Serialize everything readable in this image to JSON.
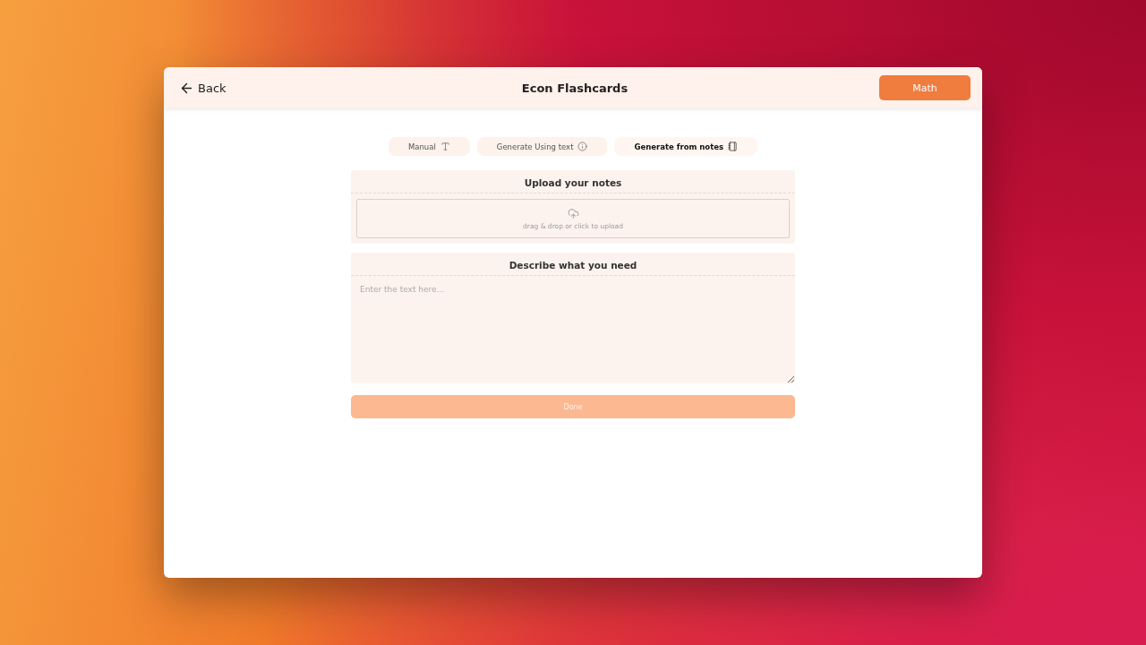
{
  "header": {
    "back": "Back",
    "title": "Econ Flashcards",
    "subject_button": "Math"
  },
  "tabs": [
    {
      "label": "Manual",
      "selected": false
    },
    {
      "label": "Generate Using text",
      "selected": false
    },
    {
      "label": "Generate from notes",
      "selected": true
    }
  ],
  "upload": {
    "title": "Upload your notes",
    "hint": "drag & drop or click to upload"
  },
  "describe": {
    "title": "Describe what you need",
    "placeholder": "Enter the text here..."
  },
  "done_button": {
    "label": "Done",
    "disabled": true
  }
}
